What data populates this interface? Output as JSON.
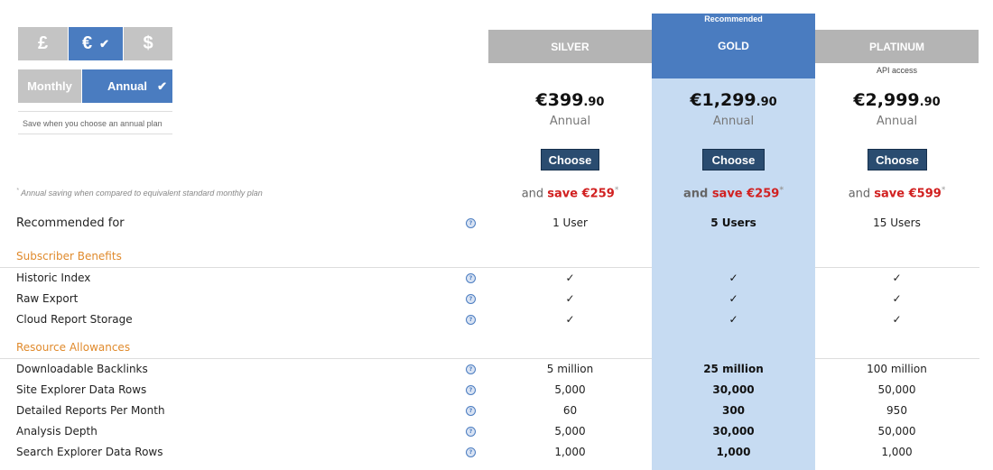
{
  "currency": {
    "options": [
      {
        "label": "£",
        "active": false
      },
      {
        "label": "€",
        "active": true
      },
      {
        "label": "$",
        "active": false
      }
    ],
    "check": "✔"
  },
  "billing": {
    "options": [
      {
        "label": "Monthly",
        "active": false
      },
      {
        "label": "Annual",
        "active": true
      }
    ],
    "note": "Save when you choose an annual plan"
  },
  "footnote": {
    "marker": "*",
    "text": "Annual saving when compared to equivalent standard monthly plan"
  },
  "plans": [
    {
      "name": "SILVER",
      "price_main": "€399",
      "price_cents": ".90",
      "period": "Annual",
      "choose": "Choose",
      "saving_prefix": "and",
      "saving": "save €259",
      "saving_marker": "*",
      "recommended_for": "1 User"
    },
    {
      "name": "GOLD",
      "badge": "Recommended",
      "price_main": "€1,299",
      "price_cents": ".90",
      "period": "Annual",
      "choose": "Choose",
      "saving_prefix": "and",
      "saving": "save €259",
      "saving_marker": "*",
      "recommended_for": "5 Users"
    },
    {
      "name": "PLATINUM",
      "note": "API access",
      "price_main": "€2,999",
      "price_cents": ".90",
      "period": "Annual",
      "choose": "Choose",
      "saving_prefix": "and",
      "saving": "save €599",
      "saving_marker": "*",
      "recommended_for": "15 Users"
    }
  ],
  "recommended_label": "Recommended for",
  "help_icon": "?",
  "sections": [
    {
      "title": "Subscriber Benefits",
      "rows": [
        {
          "label": "Historic Index",
          "values": [
            "✓",
            "✓",
            "✓"
          ]
        },
        {
          "label": "Raw Export",
          "values": [
            "✓",
            "✓",
            "✓"
          ]
        },
        {
          "label": "Cloud Report Storage",
          "values": [
            "✓",
            "✓",
            "✓"
          ]
        }
      ]
    },
    {
      "title": "Resource Allowances",
      "rows": [
        {
          "label": "Downloadable Backlinks",
          "values": [
            "5 million",
            "25 million",
            "100 million"
          ]
        },
        {
          "label": "Site Explorer Data Rows",
          "values": [
            "5,000",
            "30,000",
            "50,000"
          ]
        },
        {
          "label": "Detailed Reports Per Month",
          "values": [
            "60",
            "300",
            "950"
          ]
        },
        {
          "label": "Analysis Depth",
          "values": [
            "5,000",
            "30,000",
            "50,000"
          ]
        },
        {
          "label": "Search Explorer Data Rows",
          "values": [
            "1,000",
            "1,000",
            "1,000"
          ]
        }
      ]
    }
  ]
}
